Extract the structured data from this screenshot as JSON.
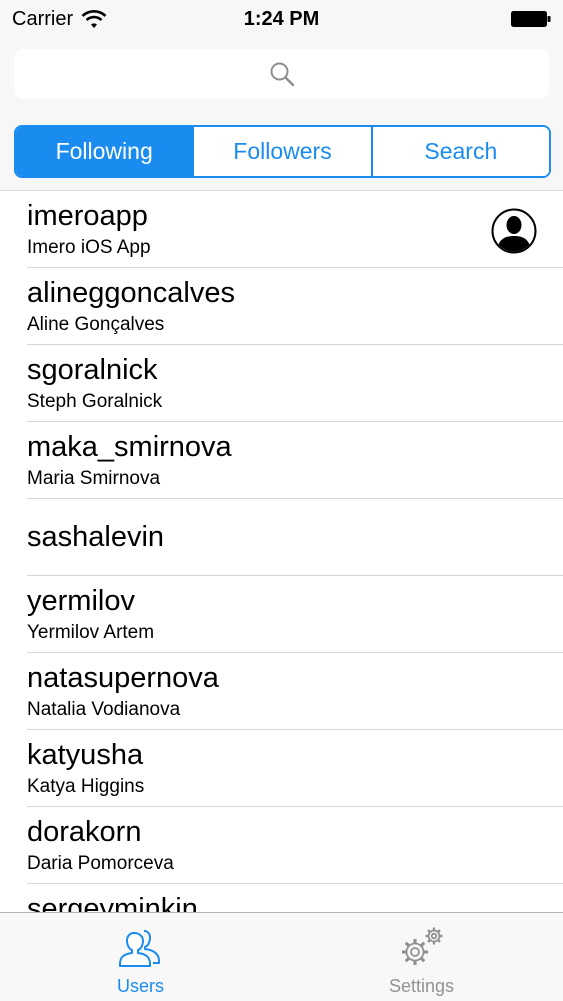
{
  "status_bar": {
    "carrier": "Carrier",
    "time": "1:24 PM"
  },
  "search": {
    "placeholder": ""
  },
  "segments": [
    {
      "label": "Following",
      "active": true
    },
    {
      "label": "Followers",
      "active": false
    },
    {
      "label": "Search",
      "active": false
    }
  ],
  "users": [
    {
      "username": "imeroapp",
      "full_name": "Imero iOS App",
      "has_avatar": true
    },
    {
      "username": "alineggoncalves",
      "full_name": "Aline Gonçalves"
    },
    {
      "username": "sgoralnick",
      "full_name": "Steph Goralnick"
    },
    {
      "username": "maka_smirnova",
      "full_name": "Maria Smirnova"
    },
    {
      "username": "sashalevin",
      "full_name": ""
    },
    {
      "username": "yermilov",
      "full_name": "Yermilov Artem"
    },
    {
      "username": "natasupernova",
      "full_name": "Natalia Vodianova"
    },
    {
      "username": "katyusha",
      "full_name": "Katya Higgins"
    },
    {
      "username": "dorakorn",
      "full_name": "Daria Pomorceva"
    },
    {
      "username": "sergeyminkin",
      "full_name": ""
    }
  ],
  "tabbar": {
    "tabs": [
      {
        "label": "Users",
        "icon": "users-icon",
        "active": true
      },
      {
        "label": "Settings",
        "icon": "gear-icon",
        "active": false
      }
    ]
  },
  "colors": {
    "accent": "#1a8cf0",
    "inactive": "#929292"
  }
}
